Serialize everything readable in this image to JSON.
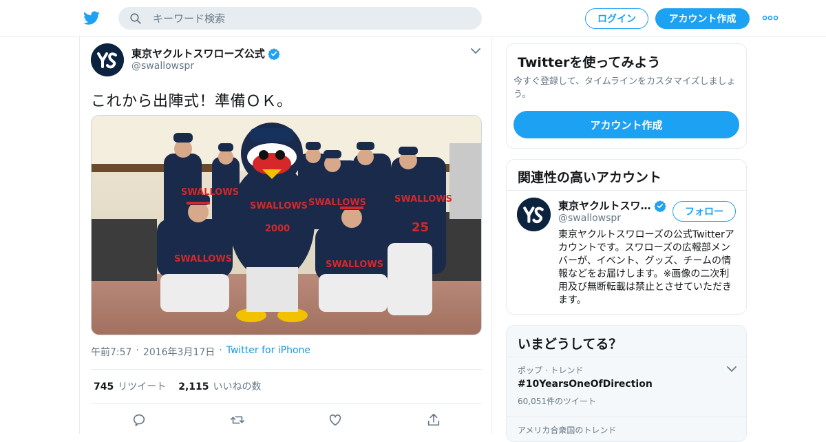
{
  "header": {
    "search_placeholder": "キーワード検索",
    "login_label": "ログイン",
    "signup_label": "アカウント作成",
    "brand_color": "#1da1f2"
  },
  "tweet": {
    "author_name": "東京ヤクルトスワローズ公式",
    "author_handle": "@swallowspr",
    "text": "これから出陣式！準備ＯＫ。",
    "time": "午前7:57",
    "date": "2016年3月17日",
    "source": "Twitter for iPhone",
    "retweets_count": "745",
    "retweets_label": "リツイート",
    "likes_count": "2,115",
    "likes_label": "いいねの数",
    "photo_jersey_text": "SWALLOWS",
    "photo_numbers": [
      "25",
      "2000"
    ]
  },
  "sidebar": {
    "try": {
      "title": "Twitterを使ってみよう",
      "description": "今すぐ登録して、タイムラインをカスタマイズしましょう。",
      "cta": "アカウント作成"
    },
    "related": {
      "title": "関連性の高いアカウント",
      "name": "東京ヤクルトスワ…",
      "handle": "@swallowspr",
      "follow_label": "フォロー",
      "bio": "東京ヤクルトスワローズの公式Twitterアカウントです。スワローズの広報部メンバーが、イベント、グッズ、チームの情報などをお届けします。※画像の二次利用及び無断転載は禁止とさせていただきます。"
    },
    "trends": {
      "title": "いまどうしてる？",
      "items": [
        {
          "context": "ポップ · トレンド",
          "name": "#10YearsOneOfDirection",
          "count": "60,051件のツイート"
        },
        {
          "context": "アメリカ合衆国のトレンド",
          "name": "",
          "count": ""
        }
      ]
    }
  }
}
